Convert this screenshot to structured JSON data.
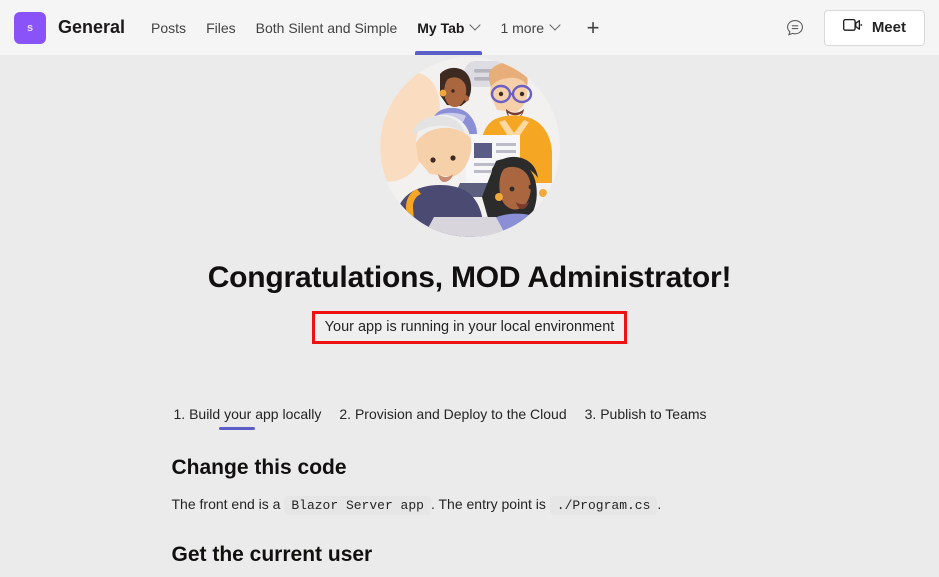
{
  "header": {
    "avatar_letter": "s",
    "channel_name": "General",
    "tabs": [
      {
        "label": "Posts",
        "active": false,
        "has_chevron": false
      },
      {
        "label": "Files",
        "active": false,
        "has_chevron": false
      },
      {
        "label": "Both Silent and Simple",
        "active": false,
        "has_chevron": false
      },
      {
        "label": "My Tab",
        "active": true,
        "has_chevron": true
      },
      {
        "label": "1 more",
        "active": false,
        "has_chevron": true
      }
    ],
    "add_tab_label": "+",
    "chat_icon": "chat-bubble-icon",
    "meet_icon": "video-camera-icon",
    "meet_label": "Meet"
  },
  "main": {
    "illustration_alt": "people-collaborating-illustration",
    "title": "Congratulations, MOD Administrator!",
    "status_text": "Your app is running in your local environment",
    "status_border_color": "#ee1111",
    "steps": [
      {
        "label": "1. Build your app locally",
        "active": true
      },
      {
        "label": "2. Provision and Deploy to the Cloud",
        "active": false
      },
      {
        "label": "3. Publish to Teams",
        "active": false
      }
    ],
    "section_change_code": {
      "heading": "Change this code",
      "text_before": "The front end is a",
      "code_1": "Blazor Server app",
      "text_middle": ". The entry point is",
      "code_2": "./Program.cs",
      "text_after": "."
    },
    "section_current_user": {
      "heading": "Get the current user"
    }
  },
  "colors": {
    "accent_purple": "#5b5fc7",
    "avatar_purple": "#8a53f7",
    "header_bg": "#f5f5f5",
    "page_bg": "#ebebeb",
    "annotation_red": "#ee1111"
  }
}
